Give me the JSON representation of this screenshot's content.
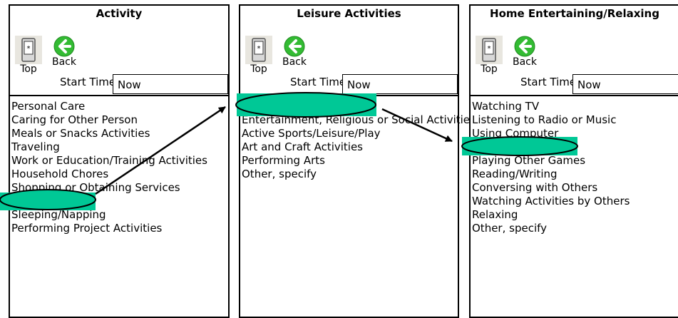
{
  "panels": [
    {
      "title": "Activity",
      "top_label": "Top",
      "back_label": "Back",
      "start_time_label": "Start Time:",
      "start_time_value": "Now",
      "items": [
        "Personal Care",
        "Caring for Other Person",
        "Meals or Snacks Activities",
        "Traveling",
        "Work or Education/Training Activities",
        "Household Chores",
        "Shopping or Obtaining Services",
        "",
        "Sleeping/Napping",
        "Performing Project Activities"
      ]
    },
    {
      "title": "Leisure Activities",
      "top_label": "Top",
      "back_label": "Back",
      "start_time_label": "Start Time:",
      "start_time_value": "Now",
      "items": [
        "",
        "Entertainment, Religious or Social Activities",
        "Active Sports/Leisure/Play",
        "Art and Craft Activities",
        "Performing Arts",
        "Other, specify"
      ]
    },
    {
      "title": "Home Entertaining/Relaxing",
      "top_label": "Top",
      "back_label": "Back",
      "start_time_label": "Start Time:",
      "start_time_value": "Now",
      "items": [
        "Watching TV",
        "Listening to Radio or Music",
        "Using Computer",
        "",
        "Playing Other Games",
        "Reading/Writing",
        "Conversing with Others",
        "Watching Activities by Others",
        "Relaxing",
        "Other, specify"
      ]
    }
  ],
  "colors": {
    "highlight": "#00c896",
    "back_icon": "#33bb33"
  },
  "icons": [
    "handheld-device-icon",
    "back-arrow-icon"
  ]
}
